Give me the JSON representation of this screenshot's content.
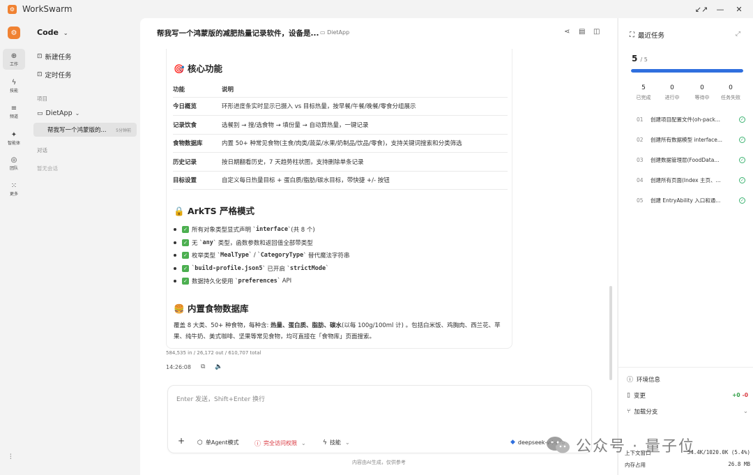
{
  "window": {
    "title": "WorkSwarm",
    "controls": [
      "↙↗",
      "—",
      "✕"
    ]
  },
  "rail": {
    "logo_glyph": "⚙",
    "items": [
      {
        "icon": "⊕",
        "label": "工作"
      },
      {
        "icon": "ϟ",
        "label": "技能"
      },
      {
        "icon": "≡",
        "label": "频道"
      },
      {
        "icon": "✦",
        "label": "智能体"
      },
      {
        "icon": "◎",
        "label": "团队"
      },
      {
        "icon": "⁙",
        "label": "更多"
      }
    ],
    "settings_icon": "⫶"
  },
  "sidebar": {
    "title": "Code",
    "new_task": "新建任务",
    "scheduled_task": "定时任务",
    "projects_label": "项目",
    "project_name": "DietApp",
    "task_title": "帮我写一个鸿蒙版的...",
    "task_time": "5分钟前",
    "dialog_label": "对话",
    "dialog_empty": "暂无会话"
  },
  "main": {
    "title": "帮我写一个鸿蒙版的减肥热量记录软件，设备是...",
    "folder": "DietApp",
    "sections": {
      "core_title": "核心功能",
      "core_emoji": "🎯",
      "arkts_title": "ArkTS 严格模式",
      "arkts_emoji": "🔒",
      "food_title": "内置食物数据库",
      "food_emoji": "🍔"
    },
    "table": {
      "headers": [
        "功能",
        "说明"
      ],
      "rows": [
        [
          "今日概览",
          "环形进度条实时显示已摄入 vs 目标热量，按早餐/午餐/晚餐/零食分组展示"
        ],
        [
          "记录饮食",
          "选餐别 → 搜/选食物 → 填份量 → 自动算热量，一键记录"
        ],
        [
          "食物数据库",
          "内置 50+ 种常见食物(主食/肉类/蔬菜/水果/奶制品/饮品/零食)，支持关键词搜索和分类筛选"
        ],
        [
          "历史记录",
          "按日期翻看历史，7 天趋势柱状图，支持删除单条记录"
        ],
        [
          "目标设置",
          "自定义每日热量目标 + 蛋白质/脂肪/碳水目标，带快捷 +/- 按钮"
        ]
      ]
    },
    "arkts_items": [
      {
        "pre": "所有对象类型显式声明 `",
        "code": "interface",
        "post": "`(共 8 个)"
      },
      {
        "pre": "无 `",
        "code": "any",
        "post": "` 类型，函数参数和返回值全部带类型"
      },
      {
        "pre": "枚举类型 `",
        "code": "MealType",
        "mid": "` / `",
        "code2": "CategoryType",
        "post": "` 替代魔法字符串"
      },
      {
        "pre": "`",
        "code": "build-profile.json5",
        "mid": "` 已开启 `",
        "code2": "strictMode",
        "post": "`"
      },
      {
        "pre": "数据持久化使用 `",
        "code": "preferences",
        "post": "` API"
      }
    ],
    "food_paragraph_pre": "覆盖 8 大类、50+ 种食物，每种含: ",
    "food_paragraph_bold": "热量、蛋白质、脂肪、碳水",
    "food_paragraph_post": "(以每 100g/100ml 计) 。包括白米饭、鸡胸肉、西兰花、苹果、纯牛奶、美式咖啡、坚果等常见食物，均可直接在「食物库」页面搜索。",
    "tokens": "584,535 in / 26,172 out / 610,707 total",
    "time": "14:26:08",
    "composer": {
      "placeholder": "Enter 发送，Shift+Enter 换行",
      "add": "+",
      "agent_mode": "单Agent模式",
      "permission": "完全访问权限",
      "skills": "技能",
      "model": "deepseek-v4-pro"
    },
    "footer_note": "内容由AI生成，仅供参考"
  },
  "right": {
    "title": "最近任务",
    "done": "5",
    "total": "/ 5",
    "progress": 1.0,
    "stats": [
      {
        "n": "5",
        "l": "已完成"
      },
      {
        "n": "0",
        "l": "进行中"
      },
      {
        "n": "0",
        "l": "等待中"
      },
      {
        "n": "0",
        "l": "任务失败"
      }
    ],
    "steps": [
      {
        "num": "01",
        "text": "创建项目配置文件(oh-pack..."
      },
      {
        "num": "02",
        "text": "创建所有数据模型 interface..."
      },
      {
        "num": "03",
        "text": "创建数据管理层(FoodData..."
      },
      {
        "num": "04",
        "text": "创建所有页面(Index 主页、..."
      },
      {
        "num": "05",
        "text": "创建 EntryAbility 入口和通..."
      }
    ],
    "env_title": "环境信息",
    "changes": "变更",
    "diff_plus": "+0",
    "diff_minus": "-0",
    "load_branch": "加载分支",
    "context_label": "上下文窗口",
    "context_value": "54.4K/1020.0K (5.4%)",
    "memory_label": "内存占用",
    "memory_value": "26.8 MB"
  },
  "watermark": {
    "text": "公众号 · 量子位"
  },
  "colors": {
    "accent": "#2f6fde",
    "brand": "#f08232",
    "success": "#3cb371",
    "danger": "#d9363e"
  }
}
